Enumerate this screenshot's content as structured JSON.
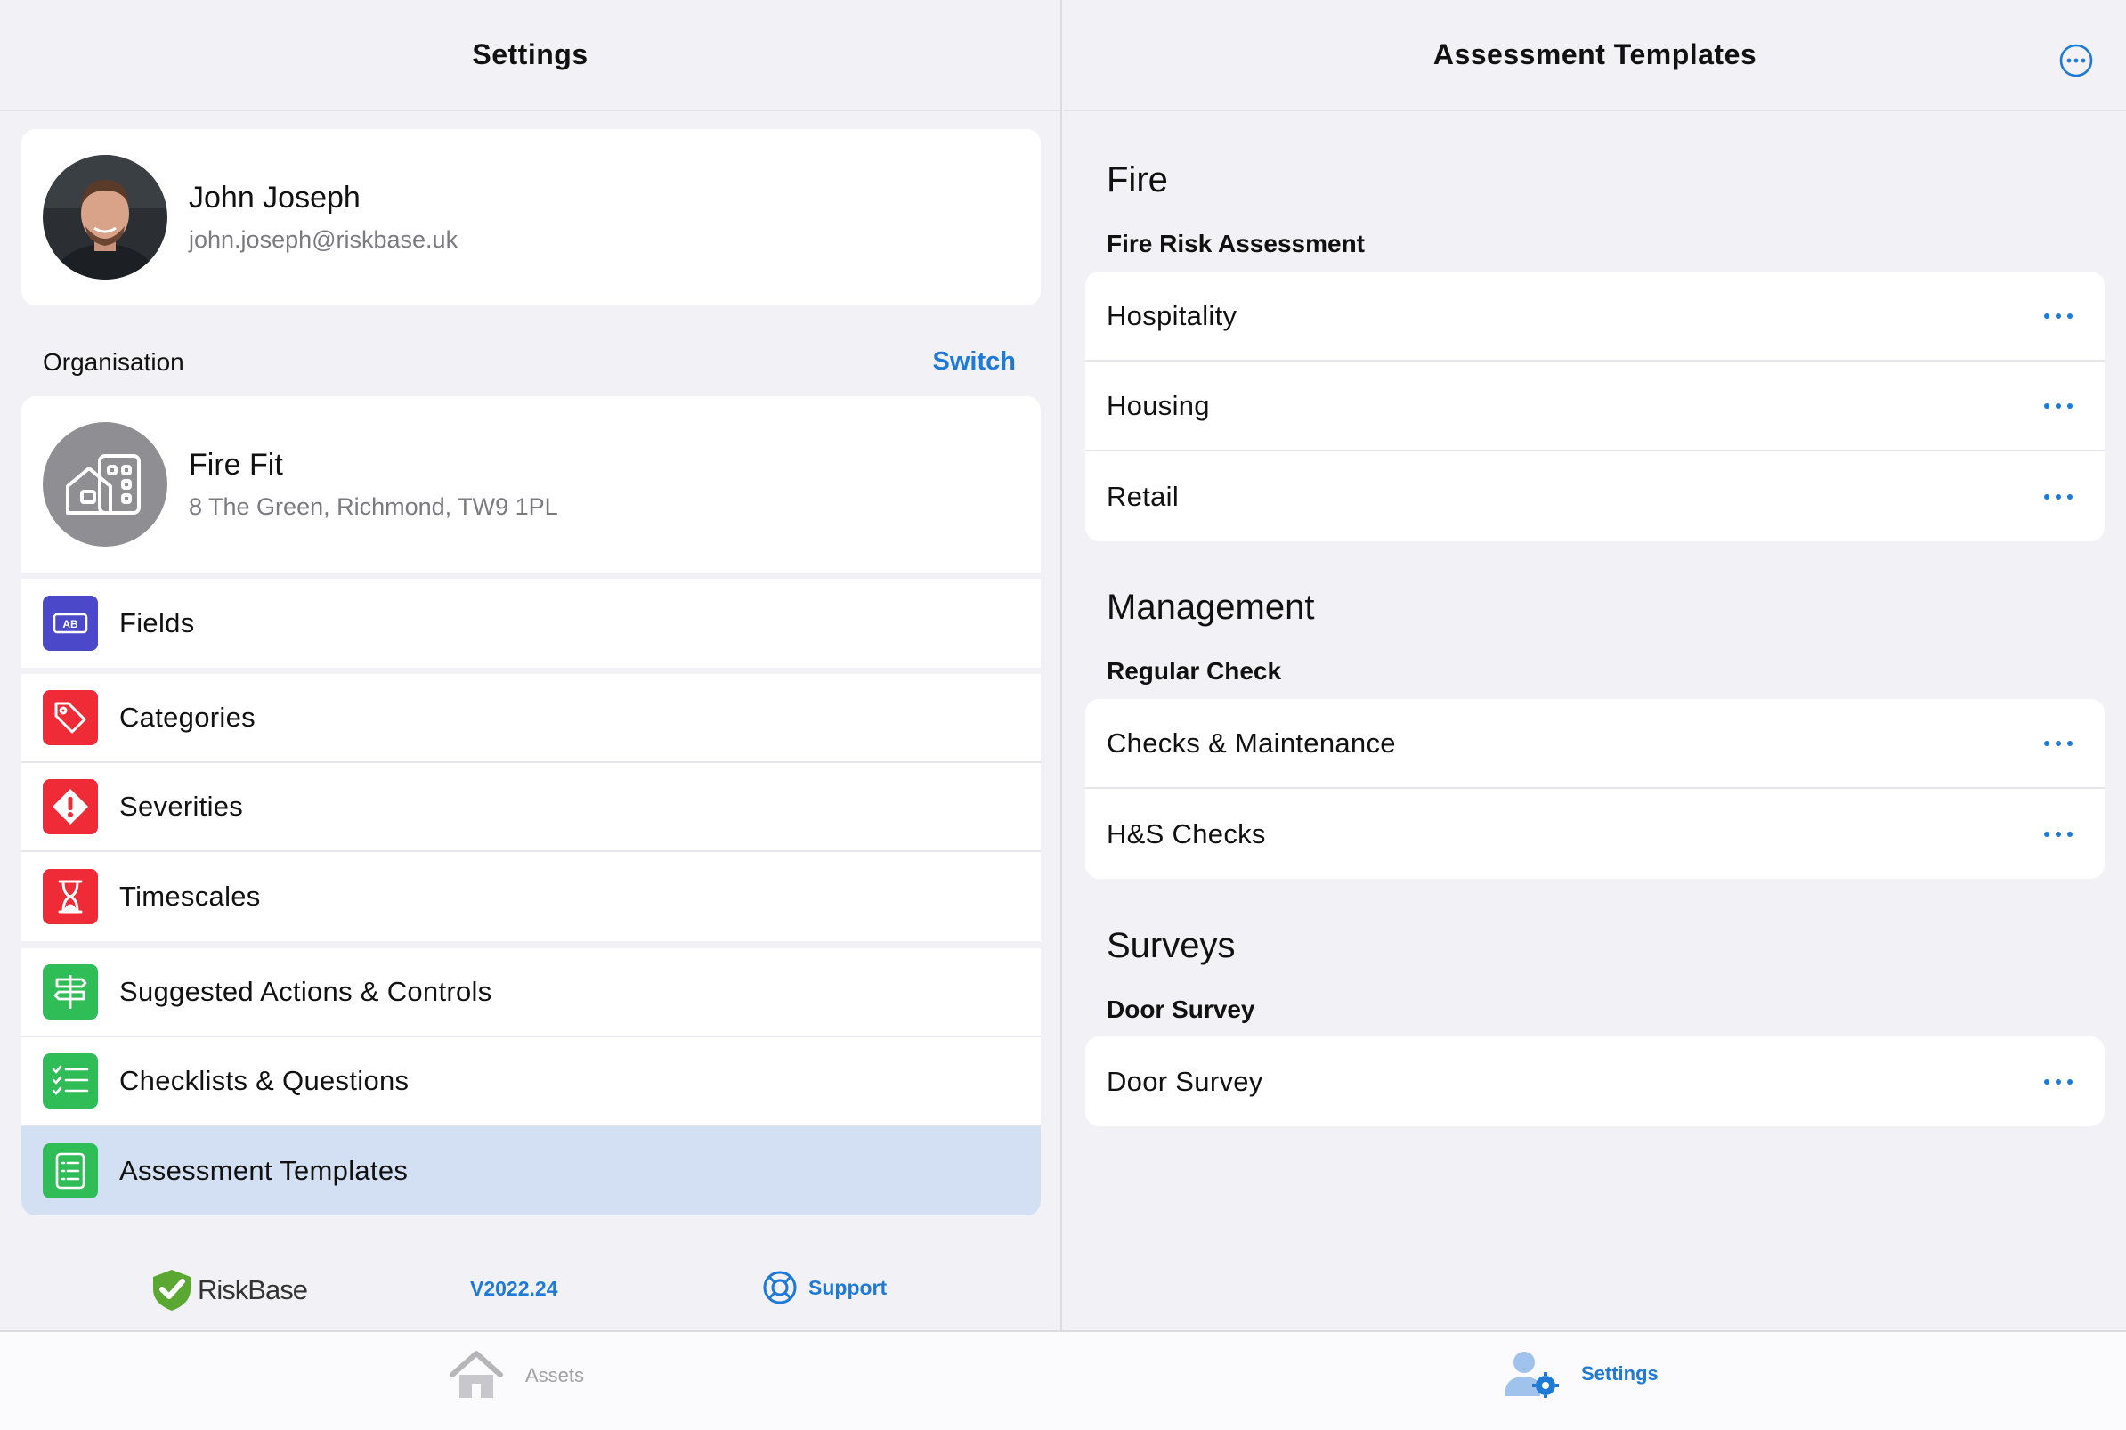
{
  "colors": {
    "accent": "#1f7ad6",
    "active_row": "#d3e0f3",
    "fields_icon": "#4b49c9",
    "red_icon": "#ee2b36",
    "green_icon": "#2fbd58",
    "logo_green": "#5aa832"
  },
  "left_pane": {
    "title": "Settings",
    "profile": {
      "name": "John Joseph",
      "email": "john.joseph@riskbase.uk",
      "avatar_icon": "user-photo"
    },
    "organisation": {
      "section_label": "Organisation",
      "switch_label": "Switch",
      "name": "Fire Fit",
      "address": "8 The Green, Richmond, TW9 1PL",
      "logo_icon": "building-icon"
    },
    "menu": [
      {
        "label": "Fields",
        "icon": "text-field-icon"
      },
      {
        "label": "Categories",
        "icon": "tag-icon"
      },
      {
        "label": "Severities",
        "icon": "warning-diamond-icon"
      },
      {
        "label": "Timescales",
        "icon": "hourglass-icon"
      },
      {
        "label": "Suggested Actions & Controls",
        "icon": "signpost-icon"
      },
      {
        "label": "Checklists & Questions",
        "icon": "checklist-icon"
      },
      {
        "label": "Assessment Templates",
        "icon": "template-list-icon",
        "selected": true
      }
    ],
    "footer": {
      "logo_text": "RiskBase",
      "version": "V2022.24",
      "support_label": "Support"
    }
  },
  "right_pane": {
    "title": "Assessment Templates",
    "more_icon": "ellipsis-circle-icon",
    "sections": [
      {
        "title": "Fire",
        "subtitle": "Fire Risk Assessment",
        "items": [
          "Hospitality",
          "Housing",
          "Retail"
        ]
      },
      {
        "title": "Management",
        "subtitle": "Regular Check",
        "items": [
          "Checks & Maintenance",
          "H&S Checks"
        ]
      },
      {
        "title": "Surveys",
        "subtitle": "Door Survey",
        "items": [
          "Door Survey"
        ]
      }
    ]
  },
  "tabbar": {
    "tabs": [
      {
        "label": "Assets",
        "icon": "house-icon",
        "selected": false
      },
      {
        "label": "Settings",
        "icon": "user-gear-icon",
        "selected": true
      }
    ]
  }
}
